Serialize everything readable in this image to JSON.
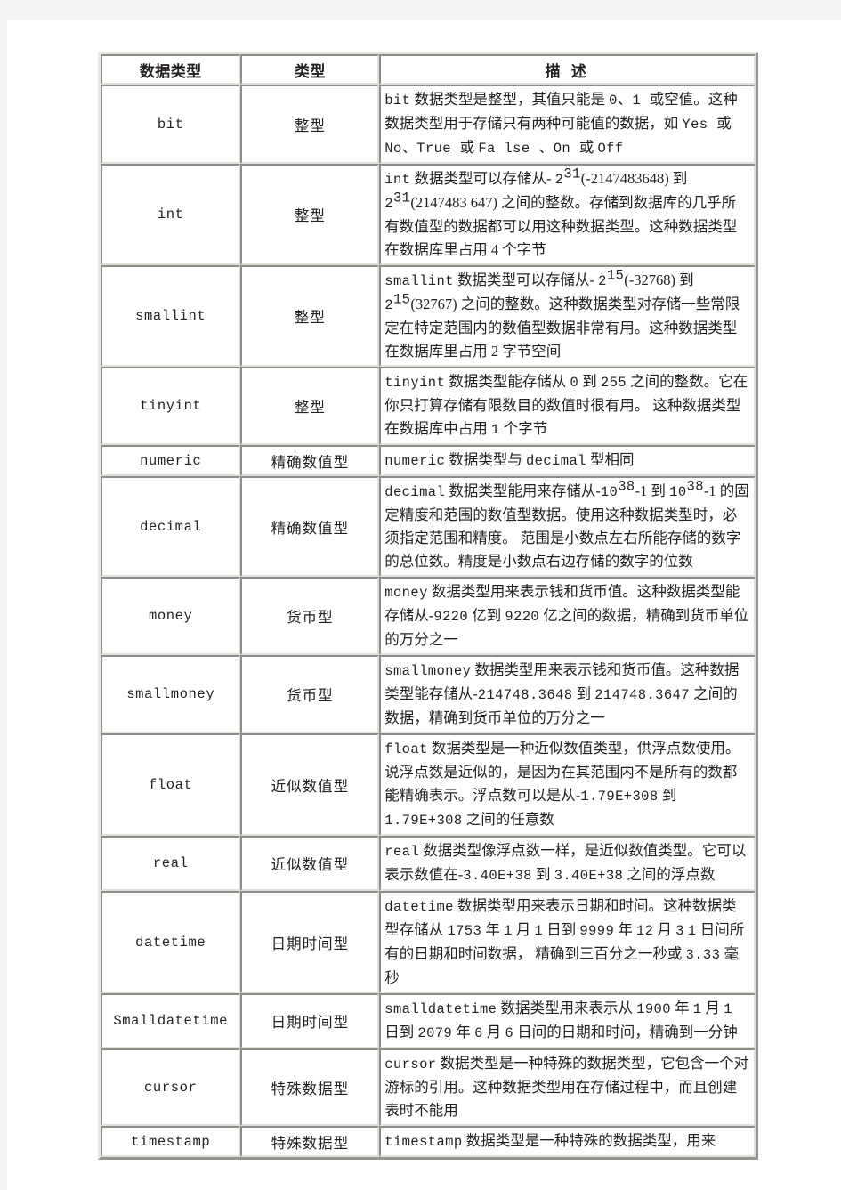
{
  "table": {
    "headers": [
      "数据类型",
      "类型",
      "描 述"
    ],
    "rows": [
      {
        "name": "bit",
        "kind": "整型",
        "desc_plain": "bit 数据类型是整型，其值只能是 0、1 或空值。这种数据类型用于存储只有两种可能值的数据，如 Yes 或 No、True 或 Fa lse 、On 或 Off"
      },
      {
        "name": "int",
        "kind": "整型",
        "desc_plain": "int 数据类型可以存储从- 2^31(-2147483648) 到 2^31(2147483 647) 之间的整数。存储到数据库的几乎所有数值型的数据都可以用这种数据类型。这种数据类型在数据库里占用 4 个字节"
      },
      {
        "name": "smallint",
        "kind": "整型",
        "desc_plain": "smallint 数据类型可以存储从- 2^15(-32768) 到 2^15(32767) 之间的整数。这种数据类型对存储一些常限定在特定范围内的数值型数据非常有用。这种数据类型在数据库里占用 2 字节空间"
      },
      {
        "name": "tinyint",
        "kind": "整型",
        "desc_plain": "tinyint 数据类型能存储从 0 到 255 之间的整数。它在你只打算存储有限数目的数值时很有用。 这种数据类型在数据库中占用 1 个字节"
      },
      {
        "name": "numeric",
        "kind": "精确数值型",
        "desc_plain": "numeric 数据类型与 decimal 型相同"
      },
      {
        "name": "decimal",
        "kind": "精确数值型",
        "desc_plain": "decimal 数据类型能用来存储从-10^38-1 到 10^38-1 的固定精度和范围的数值型数据。使用这种数据类型时，必须指定范围和精度。 范围是小数点左右所能存储的数字的总位数。精度是小数点右边存储的数字的位数"
      },
      {
        "name": "money",
        "kind": "货币型",
        "desc_plain": "money 数据类型用来表示钱和货币值。这种数据类型能存储从-9220 亿到 9220 亿之间的数据，精确到货币单位的万分之一"
      },
      {
        "name": "smallmoney",
        "kind": "货币型",
        "desc_plain": "smallmoney 数据类型用来表示钱和货币值。这种数据类型能存储从-214748.3648 到 214748.3647 之间的数据，精确到货币单位的万分之一"
      },
      {
        "name": "float",
        "kind": "近似数值型",
        "desc_plain": "float 数据类型是一种近似数值类型，供浮点数使用。说浮点数是近似的，是因为在其范围内不是所有的数都能精确表示。浮点数可以是从-1.79E+308 到 1.79E+308 之间的任意数"
      },
      {
        "name": "real",
        "kind": "近似数值型",
        "desc_plain": "real 数据类型像浮点数一样，是近似数值类型。它可以表示数值在-3.40E+38 到 3.40E+38 之间的浮点数"
      },
      {
        "name": "datetime",
        "kind": "日期时间型",
        "desc_plain": "datetime 数据类型用来表示日期和时间。这种数据类型存储从 1753 年 1 月 1 日到 9999 年 12 月 3 1 日间所有的日期和时间数据， 精确到三百分之一秒或 3.33 毫秒"
      },
      {
        "name": "Smalldatetime",
        "kind": "日期时间型",
        "desc_plain": "smalldatetime 数据类型用来表示从 1900 年 1 月 1 日到 2079 年 6 月 6 日间的日期和时间，精确到一分钟"
      },
      {
        "name": "cursor",
        "kind": "特殊数据型",
        "desc_plain": "cursor 数据类型是一种特殊的数据类型，它包含一个对游标的引用。这种数据类型用在存储过程中，而且创建表时不能用"
      },
      {
        "name": "timestamp",
        "kind": "特殊数据型",
        "desc_plain": "timestamp 数据类型是一种特殊的数据类型，用来"
      }
    ]
  },
  "desc_fragments": {
    "bit": [
      {
        "t": "mono",
        "v": "bit"
      },
      {
        "t": "cjk",
        "v": " 数据类型是整型，其值只能是 "
      },
      {
        "t": "mono",
        "v": "0"
      },
      {
        "t": "cjk",
        "v": "、"
      },
      {
        "t": "mono",
        "v": "1 "
      },
      {
        "t": "cjk",
        "v": "或空值。这种数据类型用于存储只有两种可能值的数据，如 "
      },
      {
        "t": "mono",
        "v": "Yes "
      },
      {
        "t": "cjk",
        "v": "或 "
      },
      {
        "t": "mono",
        "v": "No"
      },
      {
        "t": "cjk",
        "v": "、"
      },
      {
        "t": "mono",
        "v": "True "
      },
      {
        "t": "cjk",
        "v": "或 "
      },
      {
        "t": "mono",
        "v": "Fa lse "
      },
      {
        "t": "cjk",
        "v": "、"
      },
      {
        "t": "mono",
        "v": "On "
      },
      {
        "t": "cjk",
        "v": "或 "
      },
      {
        "t": "mono",
        "v": "Off"
      }
    ],
    "int": [
      {
        "t": "mono",
        "v": "int"
      },
      {
        "t": "cjk",
        "v": " 数据类型可以存储从- "
      },
      {
        "t": "sup-base",
        "v": "2",
        "sup": "31"
      },
      {
        "t": "cjk",
        "v": "(-2147483648) 到 "
      },
      {
        "t": "sup-base",
        "v": "2",
        "sup": "31"
      },
      {
        "t": "cjk",
        "v": "(2147483 647) 之间的整数。存储到数据库的几乎所有数值型的数据都可以用这种数据类型。这种数据类型在数据库里占用 4 个字节"
      }
    ],
    "smallint": [
      {
        "t": "mono",
        "v": "smallint"
      },
      {
        "t": "cjk",
        "v": " 数据类型可以存储从- "
      },
      {
        "t": "sup-base",
        "v": "2",
        "sup": "15"
      },
      {
        "t": "cjk",
        "v": "(-32768) 到 "
      },
      {
        "t": "sup-base",
        "v": "2",
        "sup": "15"
      },
      {
        "t": "cjk",
        "v": "(32767) 之间的整数。这种数据类型对存储一些常限定在特定范围内的数值型数据非常有用。这种数据类型在数据库里占用 2 字节空间"
      }
    ],
    "decimal": [
      {
        "t": "mono",
        "v": "decimal"
      },
      {
        "t": "cjk",
        "v": " 数据类型能用来存储从-"
      },
      {
        "t": "sup-base",
        "v": "10",
        "sup": "38"
      },
      {
        "t": "cjk",
        "v": "-1 到 "
      },
      {
        "t": "sup-base",
        "v": "10",
        "sup": "38"
      },
      {
        "t": "cjk",
        "v": "-1 的固定精度和范围的数值型数据。使用这种数据类型时，必须指定范围和精度。 范围是小数点左右所能存储的数字的总位数。精度是小数点右边存储的数字的位数"
      }
    ]
  },
  "colors": {
    "page_background": "#ffffff",
    "outer_strip": "#f4f4f4",
    "table_border": "#e9e9e3",
    "cell_border": "#e0e0da",
    "text": "#231f20"
  }
}
